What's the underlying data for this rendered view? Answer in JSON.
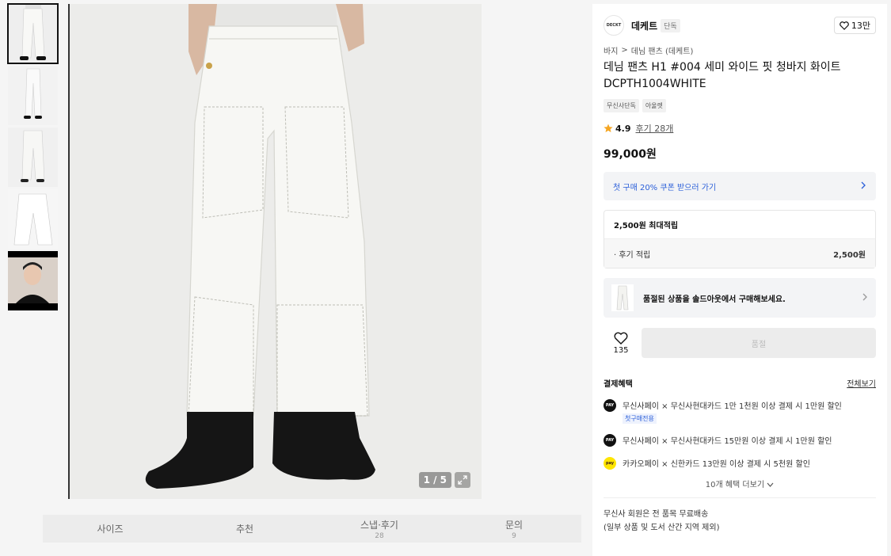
{
  "gallery": {
    "counter": "1 / 5",
    "thumbnail_names": [
      "thumb-front",
      "thumb-full",
      "thumb-back",
      "thumb-flat",
      "thumb-model"
    ]
  },
  "tabs": [
    {
      "label": "사이즈",
      "count": ""
    },
    {
      "label": "추천",
      "count": ""
    },
    {
      "label": "스냅·후기",
      "count": "28"
    },
    {
      "label": "문의",
      "count": "9"
    }
  ],
  "brand": {
    "logo_text": "DECKT",
    "name": "데케트",
    "tag": "단독",
    "likes": "13만"
  },
  "breadcrumb": {
    "level1": "바지",
    "separator": ">",
    "level2": "데님 팬츠 (데케트)"
  },
  "product": {
    "title": "데님 팬츠 H1 #004 세미 와이드 핏 청바지 화이트 DCPTH1004WHITE",
    "badges": [
      "무신사단독",
      "아울렛"
    ],
    "rating": "4.9",
    "reviews": "후기 28개",
    "price": "99,000원"
  },
  "coupon": {
    "text": "첫 구매 20% 쿠폰 받으러 가기"
  },
  "points": {
    "header": "2,500원 최대적립",
    "row_label": "· 후기 적립",
    "row_value": "2,500원"
  },
  "soldout_banner": {
    "text": "품절된 상품을 솔드아웃에서 구매해보세요."
  },
  "purchase": {
    "like_count": "135",
    "button_label": "품절"
  },
  "benefits": {
    "title": "결제혜택",
    "view_all": "전체보기",
    "items": [
      {
        "icon": "musinsa-pay-icon",
        "icon_text": "PAY",
        "text": "무신사페이 × 무신사현대카드 1만 1천원 이상 결제 시 1만원 할인",
        "tag": "첫구매전용"
      },
      {
        "icon": "musinsa-pay-icon",
        "icon_text": "PAY",
        "text": "무신사페이 × 무신사현대카드 15만원 이상 결제 시 1만원 할인",
        "tag": ""
      },
      {
        "icon": "kakao-pay-icon",
        "icon_text": "pay",
        "text": "카카오페이 × 신한카드 13만원 이상 결제 시 5천원 할인",
        "tag": ""
      }
    ],
    "more": "10개 혜택 더보기"
  },
  "shipping": {
    "line1": "무신사 회원은 전 품목 무료배송",
    "line2": "(일부 상품 및 도서 산간 지역 제외)"
  },
  "colors": {
    "accent_blue": "#2b5fd9",
    "kakao_yellow": "#fee500",
    "star": "#f5a623"
  }
}
